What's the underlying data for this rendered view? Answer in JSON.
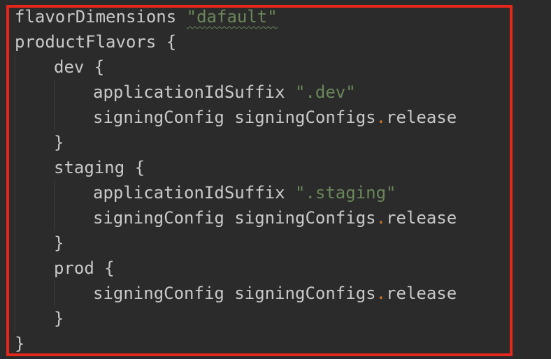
{
  "highlight_color": "#e8261c",
  "colors": {
    "background": "#2b2b2b",
    "text": "#c9c9c9",
    "string": "#6a8759",
    "operator": "#cc7832"
  },
  "code": {
    "line1": {
      "keyword": "flavorDimensions",
      "string": "\"dafault\""
    },
    "line2": {
      "text": "productFlavors {"
    },
    "dev": {
      "open": "dev {",
      "suffix_key": "applicationIdSuffix",
      "suffix_value": "\".dev\"",
      "signing_key": "signingConfig",
      "signing_obj": "signingConfigs",
      "signing_dot": ".",
      "signing_prop": "release",
      "close": "}"
    },
    "staging": {
      "open": "staging {",
      "suffix_key": "applicationIdSuffix",
      "suffix_value": "\".staging\"",
      "signing_key": "signingConfig",
      "signing_obj": "signingConfigs",
      "signing_dot": ".",
      "signing_prop": "release",
      "close": "}"
    },
    "prod": {
      "open": "prod {",
      "signing_key": "signingConfig",
      "signing_obj": "signingConfigs",
      "signing_dot": ".",
      "signing_prop": "release",
      "close": "}"
    },
    "final_close": "}"
  }
}
